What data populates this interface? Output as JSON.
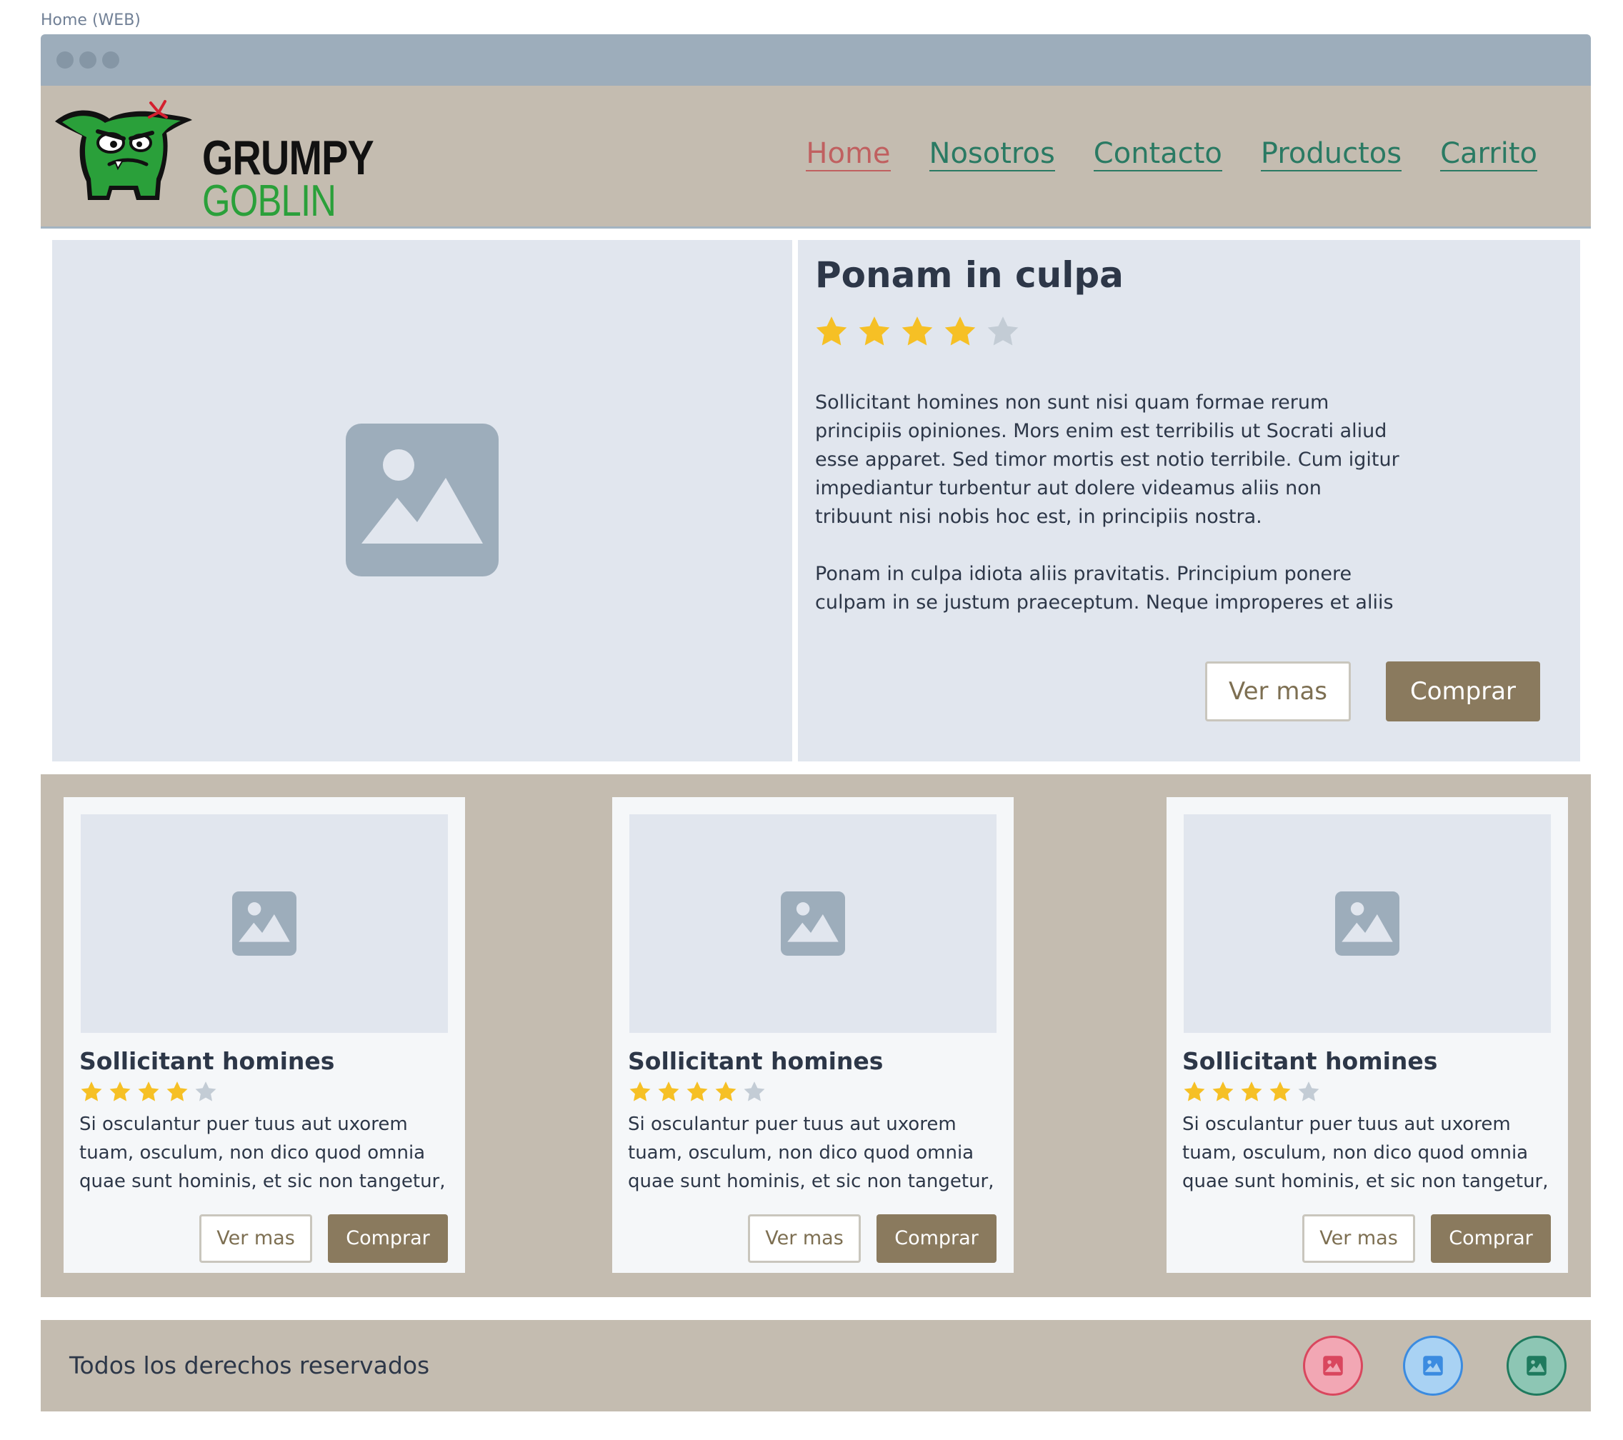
{
  "frame": {
    "label": "Home (WEB)"
  },
  "brand": {
    "line1": "GRUMPY",
    "line2": "GOBLIN",
    "logo_icon": "goblin-logo-icon"
  },
  "nav": {
    "items": [
      {
        "label": "Home",
        "active": true
      },
      {
        "label": "Nosotros",
        "active": false
      },
      {
        "label": "Contacto",
        "active": false
      },
      {
        "label": "Productos",
        "active": false
      },
      {
        "label": "Carrito",
        "active": false
      }
    ]
  },
  "hero": {
    "image_icon": "image-placeholder-icon",
    "title": "Ponam in culpa",
    "rating": 4,
    "rating_max": 5,
    "paragraph1": "Sollicitant homines non sunt nisi quam formae rerum principiis opiniones. Mors enim est terribilis ut Socrati aliud esse apparet. Sed timor mortis est notio terribile. Cum igitur impediantur turbentur aut dolere videamus aliis non tribuunt nisi nobis hoc est, in principiis nostra.",
    "paragraph2": "Ponam in culpa idiota aliis pravitatis. Principium ponere culpam in se justum praeceptum. Neque improperes et aliis",
    "secondary_button": "Ver mas",
    "primary_button": "Comprar"
  },
  "products": [
    {
      "title": "Sollicitant homines",
      "rating": 4,
      "description": "Si osculantur puer tuus aut uxorem tuam, osculum, non dico quod omnia quae sunt hominis, et sic non tangetur,",
      "secondary_button": "Ver mas",
      "primary_button": "Comprar"
    },
    {
      "title": "Sollicitant homines",
      "rating": 4,
      "description": "Si osculantur puer tuus aut uxorem tuam, osculum, non dico quod omnia quae sunt hominis, et sic non tangetur,",
      "secondary_button": "Ver mas",
      "primary_button": "Comprar"
    },
    {
      "title": "Sollicitant homines",
      "rating": 4,
      "description": "Si osculantur puer tuus aut uxorem tuam, osculum, non dico quod omnia quae sunt hominis, et sic non tangetur,",
      "secondary_button": "Ver mas",
      "primary_button": "Comprar"
    }
  ],
  "footer": {
    "copyright": "Todos los derechos reservados",
    "social": [
      {
        "icon": "image-icon",
        "color": "#d9475e"
      },
      {
        "icon": "image-icon",
        "color": "#3b8be0"
      },
      {
        "icon": "image-icon",
        "color": "#1f7a5e"
      }
    ]
  },
  "colors": {
    "header_bg": "#c4bcb0",
    "panel_bg": "#e1e6ee",
    "nav_link": "#2a7a63",
    "nav_active": "#c06060",
    "star_on": "#f6c025",
    "star_off": "#c3ccd5",
    "button_primary": "#8a7a5e"
  }
}
